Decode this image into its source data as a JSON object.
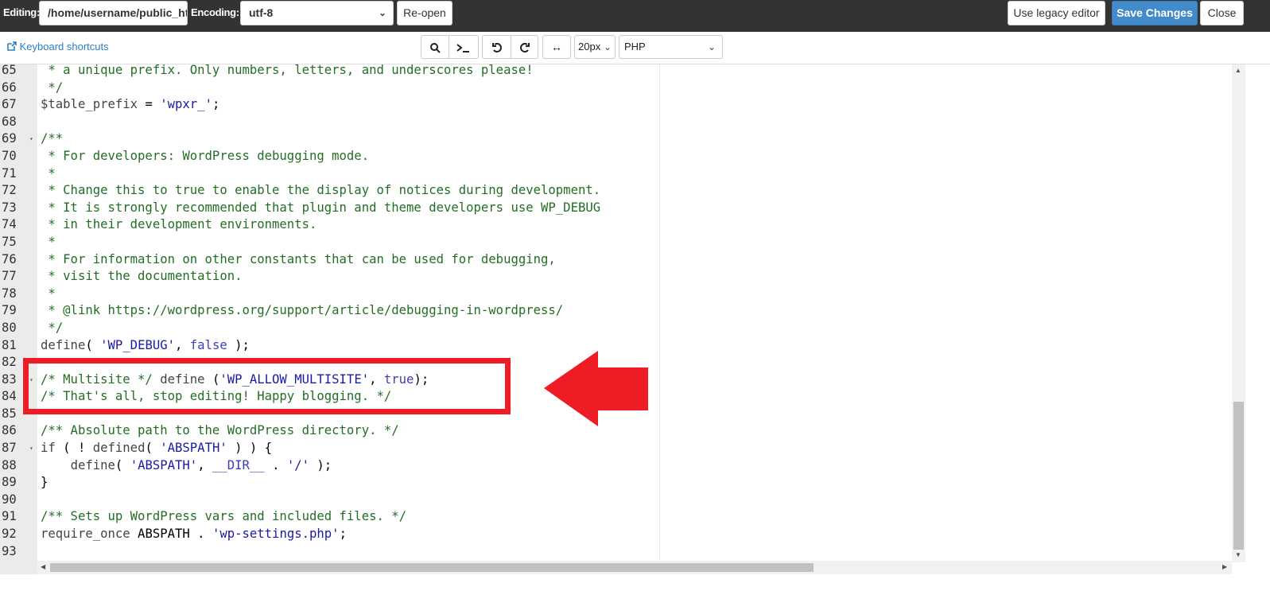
{
  "topbar": {
    "editing_label": "Editing:",
    "path_value": "/home/username/public_html/wp-config.php",
    "encoding_label": "Encoding:",
    "encoding_value": "utf-8",
    "reopen": "Re-open",
    "legacy": "Use legacy editor",
    "save": "Save Changes",
    "close": "Close"
  },
  "toolbar": {
    "keyboard_shortcuts": "Keyboard shortcuts",
    "font_size": "20px",
    "mode": "PHP"
  },
  "colors": {
    "accent": "#428bca",
    "highlight": "#ee1c25",
    "comment": "#236e24",
    "string": "#1a1aa6"
  },
  "lines": [
    {
      "n": "65",
      "t": [
        [
          "c",
          " * a unique prefix. Only numbers, letters, and underscores please!"
        ]
      ]
    },
    {
      "n": "66",
      "t": [
        [
          "c",
          " */"
        ]
      ]
    },
    {
      "n": "67",
      "t": [
        [
          "d",
          "$table_prefix"
        ],
        [
          "p",
          " = "
        ],
        [
          "s",
          "'wpxr_'"
        ],
        [
          "p",
          ";"
        ]
      ]
    },
    {
      "n": "68",
      "t": []
    },
    {
      "n": "69",
      "fold": true,
      "t": [
        [
          "c",
          "/**"
        ]
      ]
    },
    {
      "n": "70",
      "t": [
        [
          "c",
          " * For developers: WordPress debugging mode."
        ]
      ]
    },
    {
      "n": "71",
      "t": [
        [
          "c",
          " *"
        ]
      ]
    },
    {
      "n": "72",
      "t": [
        [
          "c",
          " * Change this to true to enable the display of notices during development."
        ]
      ]
    },
    {
      "n": "73",
      "t": [
        [
          "c",
          " * It is strongly recommended that plugin and theme developers use WP_DEBUG"
        ]
      ]
    },
    {
      "n": "74",
      "t": [
        [
          "c",
          " * in their development environments."
        ]
      ]
    },
    {
      "n": "75",
      "t": [
        [
          "c",
          " *"
        ]
      ]
    },
    {
      "n": "76",
      "t": [
        [
          "c",
          " * For information on other constants that can be used for debugging,"
        ]
      ]
    },
    {
      "n": "77",
      "t": [
        [
          "c",
          " * visit the documentation."
        ]
      ]
    },
    {
      "n": "78",
      "t": [
        [
          "c",
          " *"
        ]
      ]
    },
    {
      "n": "79",
      "t": [
        [
          "c",
          " * @link https://wordpress.org/support/article/debugging-in-wordpress/"
        ]
      ]
    },
    {
      "n": "80",
      "t": [
        [
          "c",
          " */"
        ]
      ]
    },
    {
      "n": "81",
      "t": [
        [
          "d",
          "define"
        ],
        [
          "p",
          "( "
        ],
        [
          "s",
          "'WP_DEBUG'"
        ],
        [
          "p",
          ", "
        ],
        [
          "k",
          "false"
        ],
        [
          "p",
          " );"
        ]
      ]
    },
    {
      "n": "82",
      "t": []
    },
    {
      "n": "83",
      "fold": true,
      "t": [
        [
          "c",
          "/* Multisite */"
        ],
        [
          "d",
          " define "
        ],
        [
          "p",
          "("
        ],
        [
          "s",
          "'WP_ALLOW_MULTISITE'"
        ],
        [
          "p",
          ", "
        ],
        [
          "k",
          "true"
        ],
        [
          "p",
          ");"
        ]
      ]
    },
    {
      "n": "84",
      "t": [
        [
          "c",
          "/* That's all, stop editing! Happy blogging. */"
        ]
      ]
    },
    {
      "n": "85",
      "t": []
    },
    {
      "n": "86",
      "t": [
        [
          "c",
          "/** Absolute path to the WordPress directory. */"
        ]
      ]
    },
    {
      "n": "87",
      "fold": true,
      "t": [
        [
          "d",
          "if"
        ],
        [
          "p",
          " ( ! "
        ],
        [
          "d",
          "defined"
        ],
        [
          "p",
          "( "
        ],
        [
          "s",
          "'ABSPATH'"
        ],
        [
          "p",
          " ) ) {"
        ]
      ]
    },
    {
      "n": "88",
      "t": [
        [
          "p",
          "    "
        ],
        [
          "d",
          "define"
        ],
        [
          "p",
          "( "
        ],
        [
          "s",
          "'ABSPATH'"
        ],
        [
          "p",
          ", "
        ],
        [
          "k",
          "__DIR__"
        ],
        [
          "p",
          " . "
        ],
        [
          "s",
          "'/'"
        ],
        [
          "p",
          " );"
        ]
      ]
    },
    {
      "n": "89",
      "t": [
        [
          "p",
          "}"
        ]
      ]
    },
    {
      "n": "90",
      "t": []
    },
    {
      "n": "91",
      "t": [
        [
          "c",
          "/** Sets up WordPress vars and included files. */"
        ]
      ]
    },
    {
      "n": "92",
      "t": [
        [
          "d",
          "require_once"
        ],
        [
          "p",
          " ABSPATH . "
        ],
        [
          "s",
          "'wp-settings.php'"
        ],
        [
          "p",
          ";"
        ]
      ]
    },
    {
      "n": "93",
      "t": []
    }
  ]
}
